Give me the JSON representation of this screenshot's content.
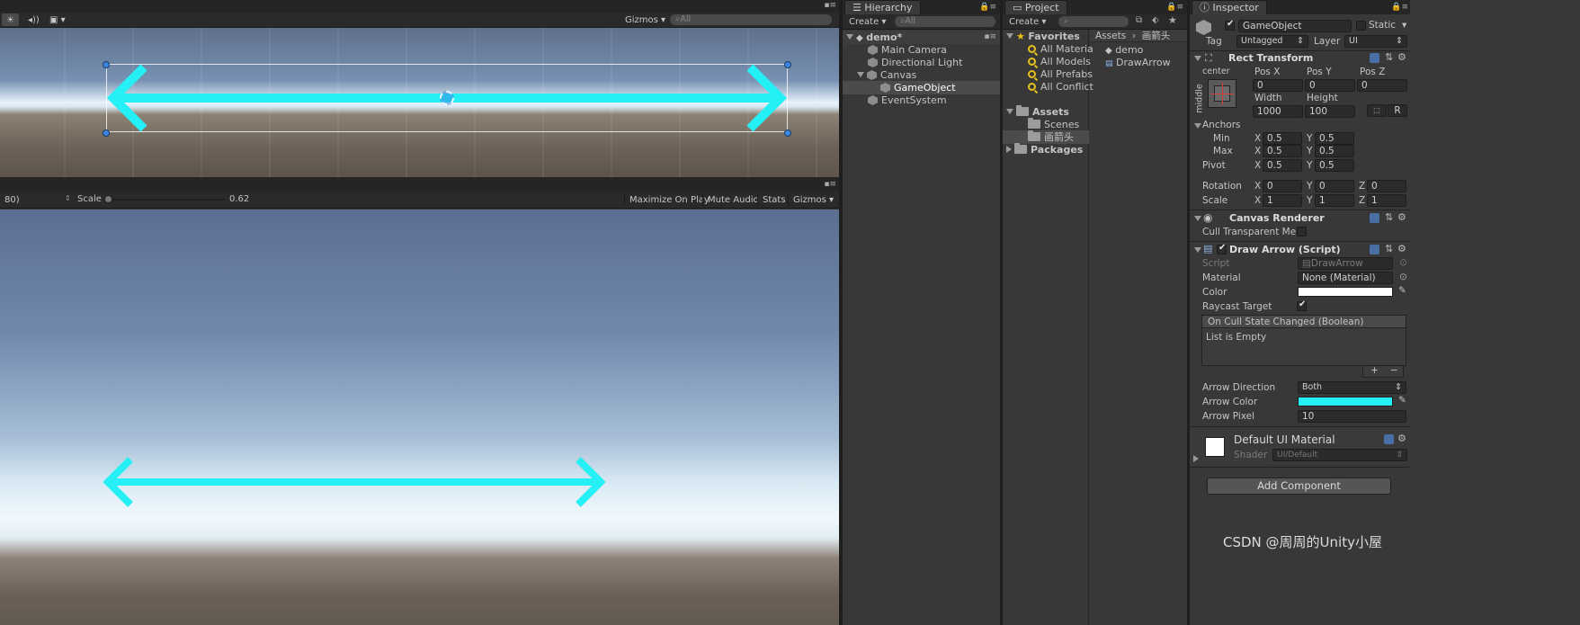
{
  "scene_toolbar": {
    "gizmos_label": "Gizmos",
    "search_placeholder": "All"
  },
  "game_toolbar": {
    "aspect_label": "80)",
    "scale_label": "Scale",
    "scale_value": "0.62",
    "scale_fraction": 0.62,
    "maximize": "Maximize On Play",
    "mute": "Mute Audio",
    "stats": "Stats",
    "gizmos": "Gizmos"
  },
  "hierarchy": {
    "tab": "Hierarchy",
    "create": "Create",
    "search_placeholder": "All",
    "scene": "demo*",
    "items": [
      {
        "label": "Main Camera"
      },
      {
        "label": "Directional Light"
      },
      {
        "label": "Canvas"
      },
      {
        "label": "GameObject"
      },
      {
        "label": "EventSystem"
      }
    ]
  },
  "project": {
    "tab": "Project",
    "create": "Create",
    "favorites": "Favorites",
    "fav_items": [
      "All Materia",
      "All Models",
      "All Prefabs",
      "All Conflict"
    ],
    "assets": "Assets",
    "asset_folders": [
      "Scenes",
      "画箭头"
    ],
    "packages": "Packages",
    "breadcrumb": [
      "Assets",
      "画箭头"
    ],
    "files": [
      "demo",
      "DrawArrow"
    ]
  },
  "inspector": {
    "tab": "Inspector",
    "object_name": "GameObject",
    "static_label": "Static",
    "tag_label": "Tag",
    "tag_value": "Untagged",
    "layer_label": "Layer",
    "layer_value": "UI",
    "rect_transform": {
      "title": "Rect Transform",
      "anchor_h": "center",
      "anchor_v": "middle",
      "posx_label": "Pos X",
      "posy_label": "Pos Y",
      "posz_label": "Pos Z",
      "posx": "0",
      "posy": "0",
      "posz": "0",
      "width_label": "Width",
      "height_label": "Height",
      "width": "1000",
      "height": "100",
      "r_button": "R",
      "anchors_label": "Anchors",
      "min_label": "Min",
      "max_label": "Max",
      "pivot_label": "Pivot",
      "x": "X",
      "y": "Y",
      "z": "Z",
      "min_x": "0.5",
      "min_y": "0.5",
      "max_x": "0.5",
      "max_y": "0.5",
      "pivot_x": "0.5",
      "pivot_y": "0.5",
      "rotation_label": "Rotation",
      "rot_x": "0",
      "rot_y": "0",
      "rot_z": "0",
      "scale_label": "Scale",
      "scale_x": "1",
      "scale_y": "1",
      "scale_z": "1"
    },
    "canvas_renderer": {
      "title": "Canvas Renderer",
      "cull_label": "Cull Transparent Me"
    },
    "draw_arrow": {
      "title": "Draw Arrow (Script)",
      "script_label": "Script",
      "script_value": "DrawArrow",
      "material_label": "Material",
      "material_value": "None (Material)",
      "color_label": "Color",
      "color_value": "#ffffff",
      "raycast_label": "Raycast Target",
      "event_header": "On Cull State Changed (Boolean)",
      "event_empty": "List is Empty",
      "plus": "+",
      "minus": "−",
      "direction_label": "Arrow Direction",
      "direction_value": "Both",
      "arrow_color_label": "Arrow Color",
      "arrow_color_value": "#25f0f5",
      "arrow_pixel_label": "Arrow Pixel",
      "arrow_pixel_value": "10"
    },
    "material": {
      "title": "Default UI Material",
      "shader_label": "Shader",
      "shader_value": "UI/Default"
    },
    "add_component": "Add Component"
  },
  "watermark": "CSDN @周周的Unity小屋",
  "colors": {
    "arrow": "#25f0f5",
    "panel": "#383838",
    "selected": "#2c5d87"
  }
}
